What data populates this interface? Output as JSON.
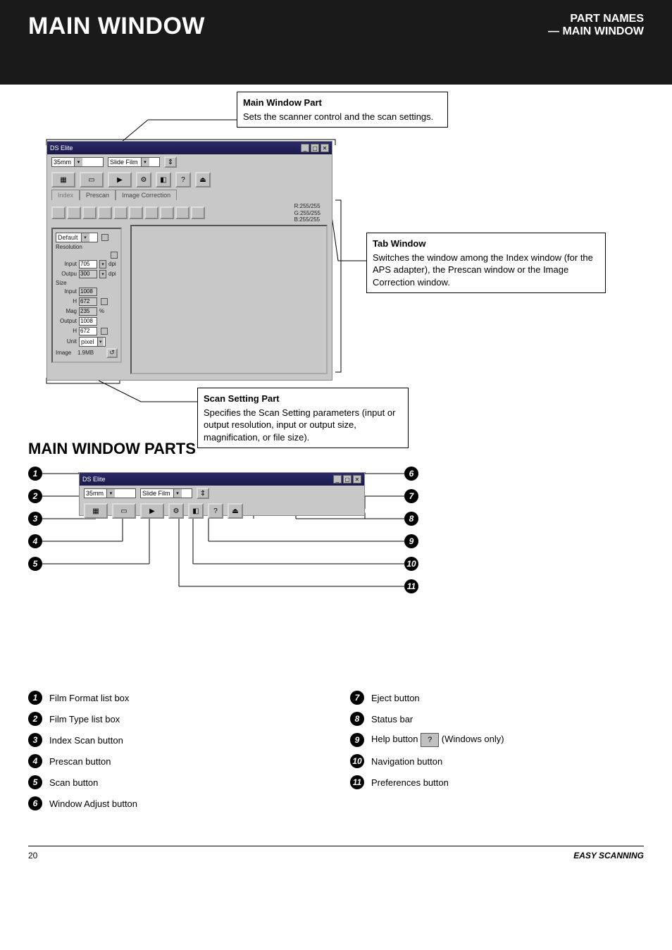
{
  "header": {
    "title": "MAIN WINDOW",
    "subtitle_line1": "PART NAMES",
    "subtitle_line2": "— MAIN WINDOW"
  },
  "sections": {
    "main_window": "MAIN WINDOW",
    "main_window_parts": "MAIN WINDOW PARTS"
  },
  "app": {
    "title": "DS Elite",
    "film_format": "35mm",
    "film_type": "Slide Film",
    "tabs": {
      "index": "Index",
      "prescan": "Prescan",
      "image_correction": "Image Correction"
    },
    "rgb": {
      "r": "R:255/255",
      "g": "G:255/255",
      "b": "B:255/255"
    }
  },
  "settings": {
    "default_label": "Default",
    "resolution_label": "Resolution",
    "input_label": "Input",
    "output_label": "Outpu",
    "size_label": "Size",
    "size_input_label": "Input",
    "h_label": "H",
    "mag_label": "Mag",
    "size_output_label": "Output",
    "unit_label": "Unit",
    "image_label": "Image",
    "dpi": "dpi",
    "percent": "%",
    "res_in": "705",
    "res_out": "300",
    "size_in_w": "1008",
    "size_in_h": "672",
    "mag": "235",
    "size_out_w": "1008",
    "size_out_h": "672",
    "unit": "pixel",
    "image_size": "1.9MB"
  },
  "callouts": {
    "c1_title": "Main Window Part",
    "c1_body": "Sets the scanner control and the scan settings.",
    "c2_title": "Tab Window",
    "c2_body": "Switches the window among the Index window (for the APS adapter), the Prescan window or the Image Correction window.",
    "c3_title": "Scan Setting Part",
    "c3_body": "Specifies the Scan Setting parameters (input or output resolution, input or output size, magnification, or file size)."
  },
  "circles": {
    "1": "1",
    "2": "2",
    "3": "3",
    "4": "4",
    "5": "5",
    "6": "6",
    "7": "7",
    "8": "8",
    "9": "9",
    "10": "10",
    "11": "11"
  },
  "legend": {
    "l1": "Film Format list box",
    "l2": "Film Type list box",
    "l3": "Index Scan button",
    "l4": "Prescan button",
    "l5": "Scan button",
    "l6": "Window Adjust button",
    "l7": "Eject button",
    "l8": "Status bar",
    "l9a": "Help button",
    "l9b": "(Windows only)",
    "l10": "Navigation button",
    "l11": "Preferences button"
  },
  "footer": {
    "page": "20",
    "section": "EASY SCANNING"
  }
}
